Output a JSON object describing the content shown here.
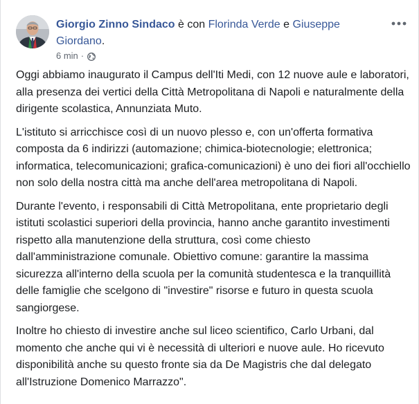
{
  "post": {
    "author": "Giorgio Zinno Sindaco",
    "with_text": " è con ",
    "tagged_1": "Florinda Verde",
    "and_text": " e ",
    "tagged_2": "Giuseppe Giordano",
    "end_punct": ".",
    "timestamp": "6 min",
    "dot": "·",
    "privacy_icon": "globe-icon",
    "more_icon": "more-options-icon",
    "paragraphs": [
      "Oggi abbiamo inaugurato il Campus dell'Iti Medi, con 12 nuove aule e laboratori, alla presenza dei vertici della Città Metropolitana di Napoli e naturalmente della dirigente scolastica, Annunziata Muto.",
      "L'istituto si arricchisce così di un nuovo plesso e, con un'offerta formativa composta da 6 indirizzi (automazione; chimica-biotecnologie; elettronica; informatica, telecomunicazioni; grafica-comunicazioni) è uno dei fiori all'occhiello non solo della nostra città ma anche dell'area metropolitana di Napoli.",
      "Durante l'evento, i responsabili di Città Metropolitana, ente proprietario degli istituti scolastici superiori della provincia, hanno anche garantito investimenti rispetto alla manutenzione della struttura, così come chiesto dall'amministrazione comunale. Obiettivo comune: garantire la massima sicurezza all'interno della scuola per la comunità studentesca e la tranquillità delle famiglie che scelgono di \"investire\" risorse e futuro in questa scuola sangiorgese.",
      "Inoltre ho chiesto di investire anche sul liceo scientifico, Carlo Urbani, dal momento che anche qui vi è necessità di ulteriori e nuove aule. Ho ricevuto disponibilità anche su questo fronte sia da De Magistris che dal delegato all'Istruzione Domenico Marrazzo\"."
    ]
  },
  "colors": {
    "link": "#385898",
    "text": "#1c1e21",
    "meta": "#606770"
  }
}
